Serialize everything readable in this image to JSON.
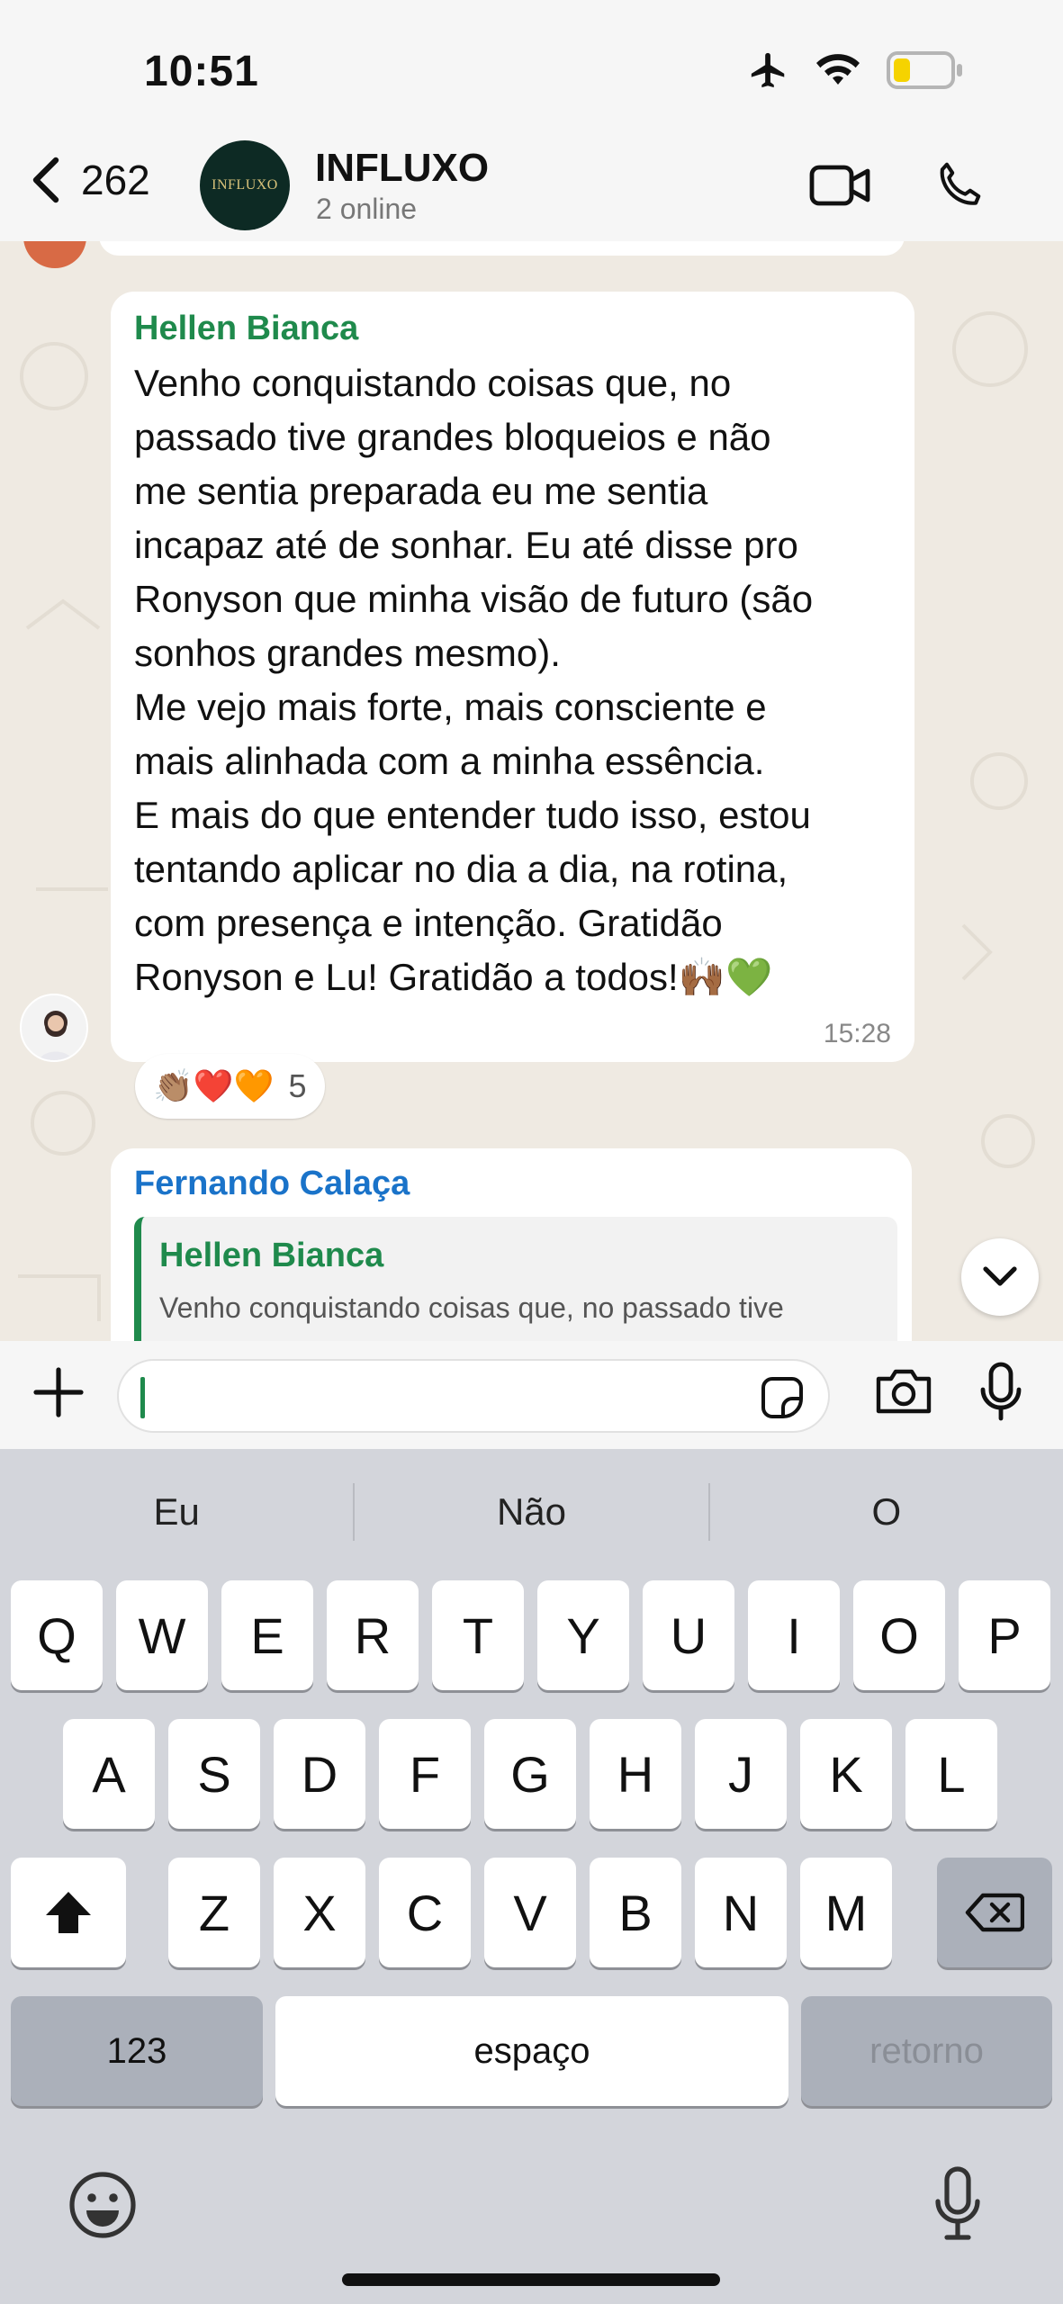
{
  "status_bar": {
    "time": "10:51"
  },
  "header": {
    "back_count": "262",
    "group_logo_text": "INFLUXO",
    "title": "INFLUXO",
    "subtitle": "2 online"
  },
  "messages": [
    {
      "sender": "Hellen Bianca",
      "text": "Venho conquistando coisas que, no\npassado tive grandes bloqueios e não\nme sentia preparada eu me sentia\nincapaz até de sonhar. Eu até disse pro\nRonyson que minha visão de futuro (são\nsonhos grandes mesmo).\nMe vejo mais forte, mais consciente e\nmais alinhada com a minha essência.\nE mais do que entender tudo isso, estou\ntentando aplicar no dia a dia, na rotina,\ncom presença e intenção. Gratidão\nRonyson e Lu! Gratidão a todos!🙌🏾💚",
      "time": "15:28",
      "reactions": {
        "emojis": "👏🏽❤️🧡",
        "count": "5"
      }
    },
    {
      "sender": "Fernando Calaça",
      "quote": {
        "name": "Hellen Bianca",
        "text": "Venho conquistando coisas que, no passado tive"
      }
    }
  ],
  "input": {
    "placeholder": ""
  },
  "keyboard": {
    "suggestions": [
      "Eu",
      "Não",
      "O"
    ],
    "row1": [
      "Q",
      "W",
      "E",
      "R",
      "T",
      "Y",
      "U",
      "I",
      "O",
      "P"
    ],
    "row2": [
      "A",
      "S",
      "D",
      "F",
      "G",
      "H",
      "J",
      "K",
      "L"
    ],
    "row3": [
      "Z",
      "X",
      "C",
      "V",
      "B",
      "N",
      "M"
    ],
    "numbers_label": "123",
    "space_label": "espaço",
    "return_label": "retorno"
  },
  "colors": {
    "accent_green": "#1f8a4c",
    "sender_blue": "#1a73c9",
    "chat_background": "#efeae2"
  }
}
